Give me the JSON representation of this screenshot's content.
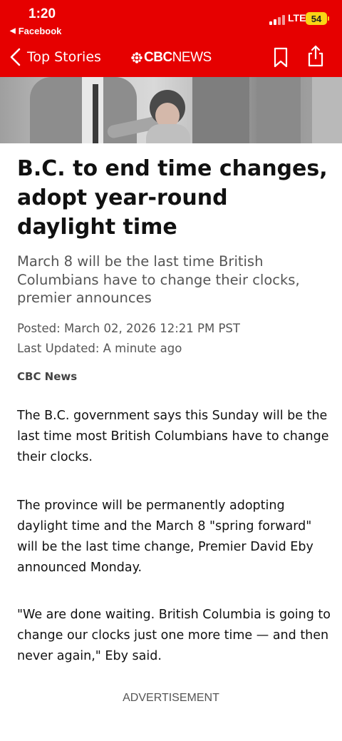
{
  "status_bar": {
    "time": "1:20",
    "back_app": "Facebook",
    "network": "LTE",
    "battery": "54"
  },
  "header": {
    "back_label": "Top Stories",
    "brand_cbc": "CBC",
    "brand_news": "NEWS"
  },
  "article": {
    "headline": "B.C. to end time changes, adopt year-round daylight time",
    "subheadline": "March 8 will be the last time British Columbians have to change their clocks, premier announces",
    "posted": "Posted: March 02, 2026 12:21 PM PST",
    "updated": "Last Updated: A minute ago",
    "byline": "CBC News",
    "paragraphs": [
      "The B.C. government says this Sunday will be the last time most British Columbians have to change their clocks.",
      "The province will be permanently adopting daylight time and the March 8 \"spring forward\" will be the last time change, Premier David Eby announced Monday.",
      "\"We are done waiting. British Columbia is going to change our clocks just one more time — and then never again,\" Eby said."
    ],
    "advertisement_label": "ADVERTISEMENT"
  },
  "colors": {
    "brand_red": "#e60000",
    "battery_yellow": "#f9d515"
  }
}
